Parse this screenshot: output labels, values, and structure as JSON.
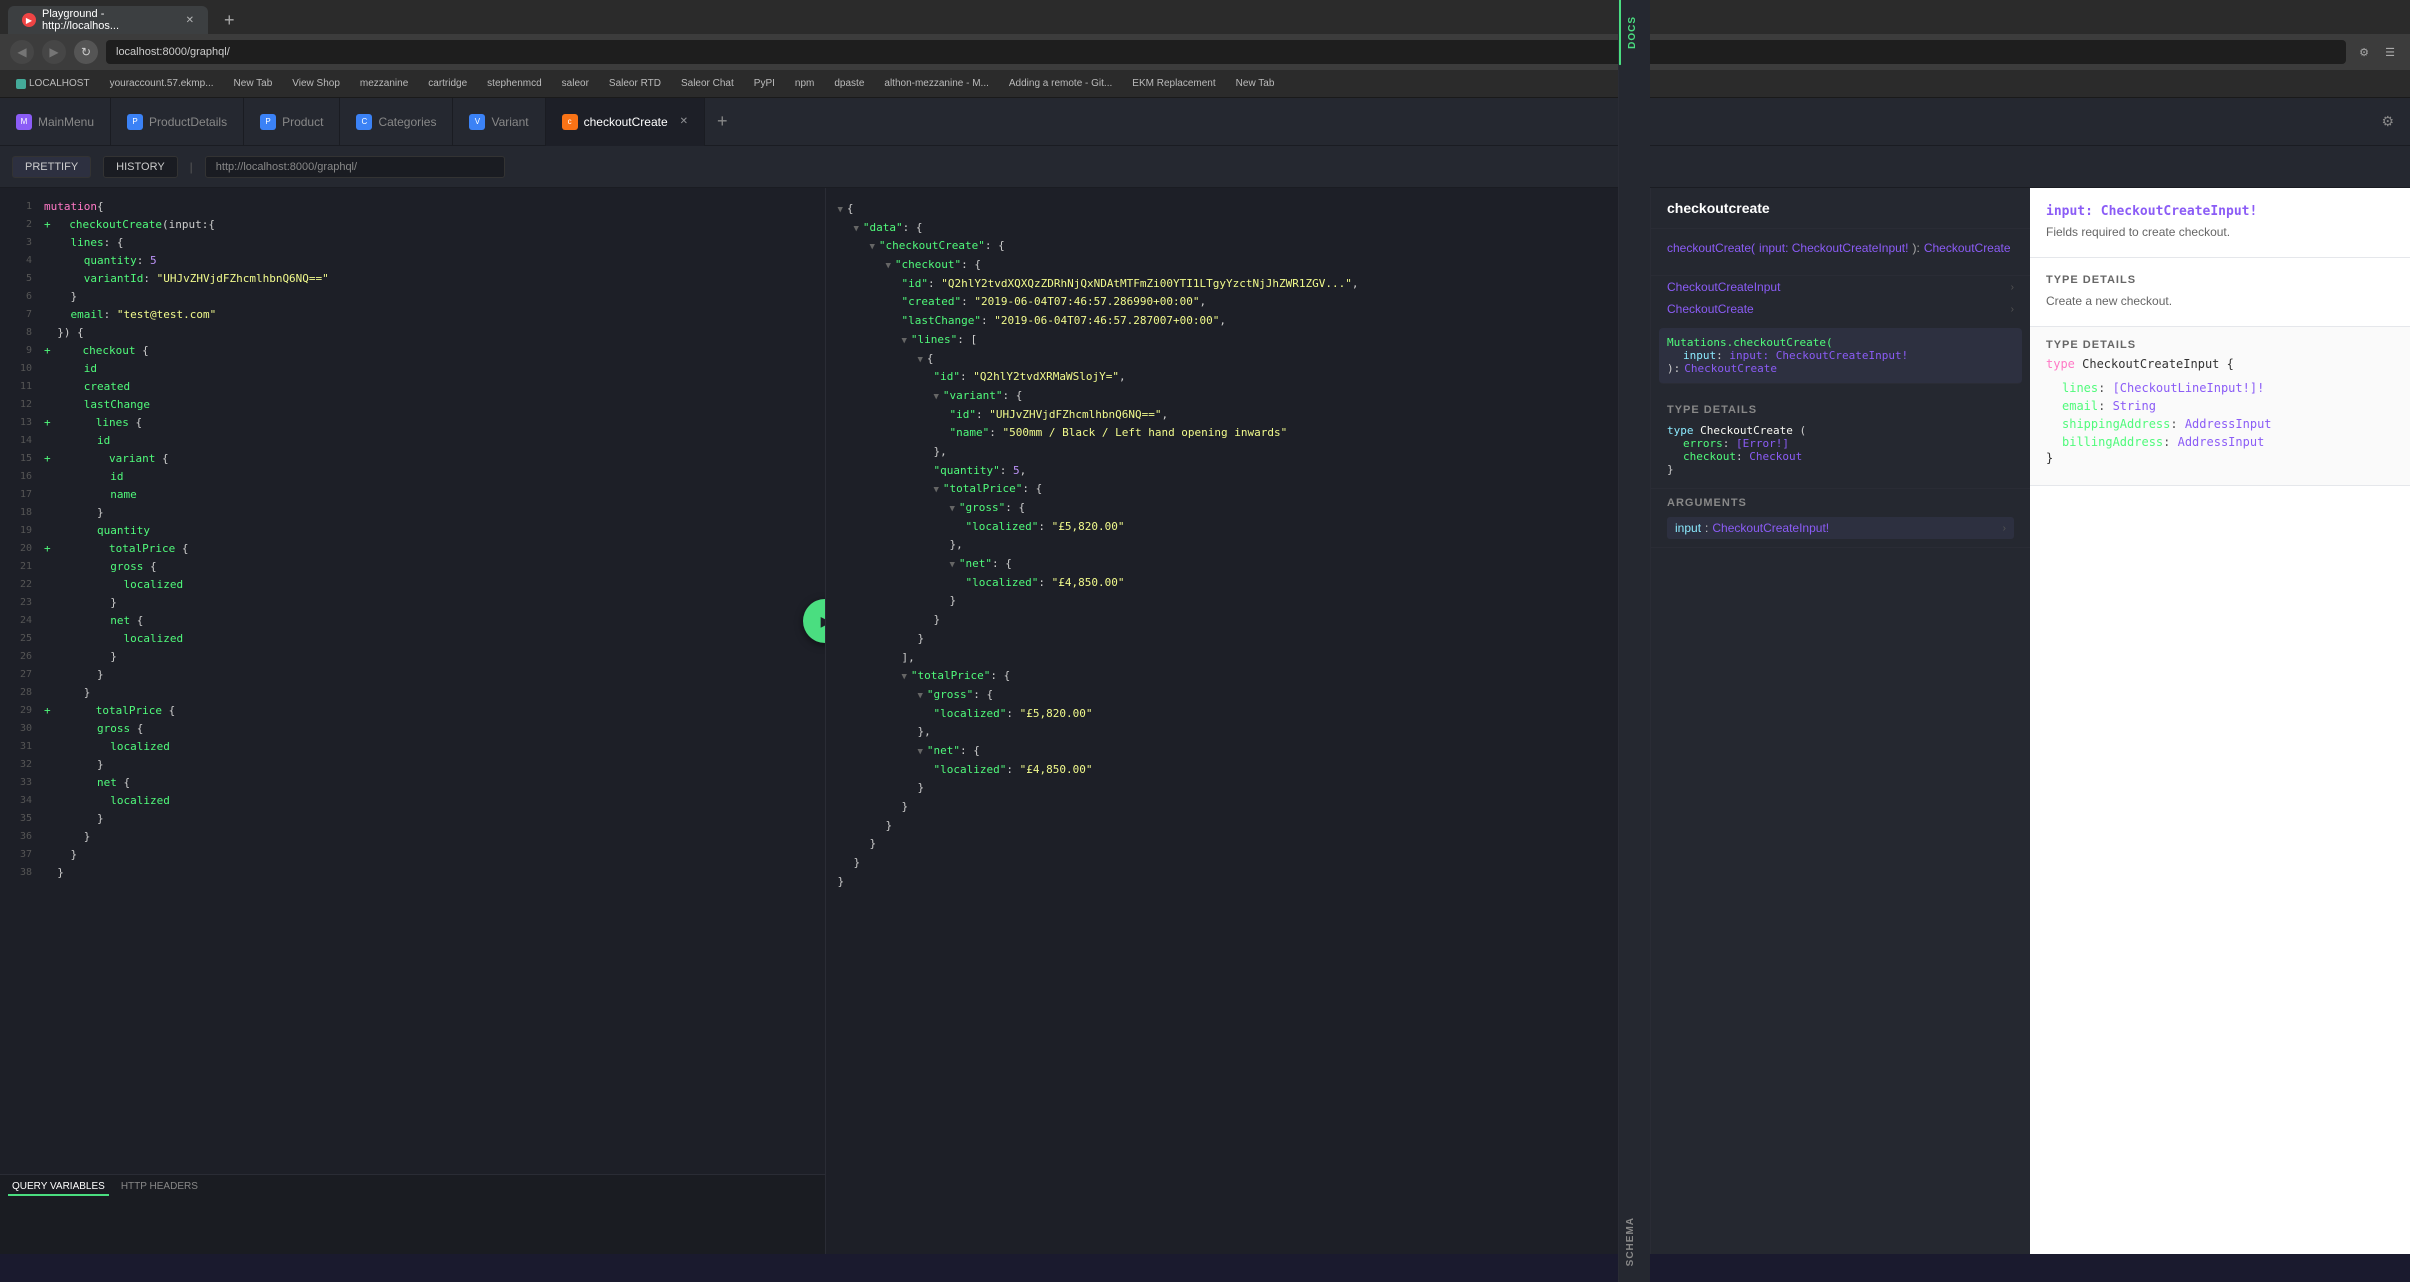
{
  "browser": {
    "tab1_title": "Playground - http://localhos...",
    "tab1_url": "localhost:8000/graphql/",
    "address": "localhost:8000/graphql/",
    "favicon_color": "#e44"
  },
  "bookmarks": [
    "LOCALHOST",
    "youraccount.57.ekmp...",
    "New Tab",
    "View Shop",
    "mezzanine",
    "cartridge",
    "stephenmcd",
    "saleor",
    "Saleor RTD",
    "Saleor Chat",
    "PyPI",
    "npm",
    "dpaste",
    "althon-mezzanine - M...",
    "Adding a remote - Git...",
    "EKM Replacement",
    "New Tab"
  ],
  "app_tabs": [
    {
      "label": "MainMenu",
      "icon_type": "purple",
      "icon_letter": "M",
      "active": false
    },
    {
      "label": "ProductDetails",
      "icon_type": "blue",
      "icon_letter": "P",
      "active": false
    },
    {
      "label": "Product",
      "icon_type": "blue",
      "icon_letter": "P",
      "active": false
    },
    {
      "label": "Categories",
      "icon_type": "blue",
      "icon_letter": "C",
      "active": false
    },
    {
      "label": "Variant",
      "icon_type": "blue",
      "icon_letter": "V",
      "active": false
    },
    {
      "label": "checkoutCreate",
      "icon_type": "orange",
      "icon_letter": "c",
      "active": true,
      "closeable": true
    }
  ],
  "toolbar": {
    "prettify": "PRETTIFY",
    "history": "HISTORY",
    "url": "http://localhost:8000/graphql/"
  },
  "query_lines": [
    {
      "num": "1",
      "content": "mutation{",
      "tokens": [
        {
          "t": "mutation",
          "c": "kw-mutation"
        },
        {
          "t": "{",
          "c": "punct"
        }
      ]
    },
    {
      "num": "2",
      "content": "  checkoutCreate(input:{",
      "indicator": "+"
    },
    {
      "num": "3",
      "content": "    lines: {"
    },
    {
      "num": "4",
      "content": "      quantity: 5",
      "value_type": "num"
    },
    {
      "num": "5",
      "content": "      variantId: \"UHJvZHVjdFZhcmlhbnQ6NQ==\"",
      "value_type": "str"
    },
    {
      "num": "6",
      "content": "    }"
    },
    {
      "num": "7",
      "content": "    email: \"test@test.com\"",
      "value_type": "str"
    },
    {
      "num": "8",
      "content": "  }) {"
    },
    {
      "num": "9",
      "content": "    checkout {",
      "indicator": "+"
    },
    {
      "num": "10",
      "content": "      id"
    },
    {
      "num": "11",
      "content": "      created"
    },
    {
      "num": "12",
      "content": "      lastChange"
    },
    {
      "num": "13",
      "content": "      lines {",
      "indicator": "+"
    },
    {
      "num": "14",
      "content": "        id"
    },
    {
      "num": "15",
      "content": "        variant {",
      "indicator": "+"
    },
    {
      "num": "16",
      "content": "          id"
    },
    {
      "num": "17",
      "content": "          name"
    },
    {
      "num": "18",
      "content": "        }"
    },
    {
      "num": "19",
      "content": "        quantity"
    },
    {
      "num": "20",
      "content": "        totalPrice {",
      "indicator": "+"
    },
    {
      "num": "21",
      "content": "          gross {"
    },
    {
      "num": "22",
      "content": "            localized"
    },
    {
      "num": "23",
      "content": "          }"
    },
    {
      "num": "24",
      "content": "          net {"
    },
    {
      "num": "25",
      "content": "            localized"
    },
    {
      "num": "26",
      "content": "          }"
    },
    {
      "num": "27",
      "content": "        }"
    },
    {
      "num": "28",
      "content": "      }"
    },
    {
      "num": "29",
      "content": "      totalPrice {",
      "indicator": "+"
    },
    {
      "num": "30",
      "content": "        gross {"
    },
    {
      "num": "31",
      "content": "          localized"
    },
    {
      "num": "32",
      "content": "        }"
    },
    {
      "num": "33",
      "content": "        net {"
    },
    {
      "num": "34",
      "content": "          localized"
    },
    {
      "num": "35",
      "content": "        }"
    },
    {
      "num": "36",
      "content": "      }"
    },
    {
      "num": "37",
      "content": "    }"
    },
    {
      "num": "38",
      "content": "  }"
    }
  ],
  "response": {
    "raw": "{\n  \"data\": {\n    \"checkoutCreate\": {\n      \"checkout\": {\n        \"id\": \"Q2hlY2tvdXQXQzZDRhNjQxNDAtMTFmZi00YTI1LTgyYzctNjJhZWR1ZGV...\",\n        \"created\": \"2019-06-04T07:46:57.286990+00:00\",\n        \"lastChange\": \"2019-06-04T07:46:57.287007+00:00\",\n        \"lines\": [\n          {\n            \"id\": \"Q2hlY2tvdXRMaWSlojY=\",\n            \"variant\": {\n              \"id\": \"UHJvZHVjdFZhcmlhbnQ6NQ==\",\n              \"name\": \"500mm / Black / Left hand opening inwards\"\n            },\n            \"quantity\": 5,\n            \"totalPrice\": {\n              \"gross\": {\n                \"localized\": \"£5,820.00\"\n              },\n              \"net\": {\n                \"localized\": \"£4,850.00\"\n              }\n            }\n          }\n        ],\n        \"totalPrice\": {\n          \"gross\": {\n            \"localized\": \"£5,820.00\"\n          },\n          \"net\": {\n            \"localized\": \"£4,850.00\"\n          }\n        }\n      }\n    }\n  }\n}"
  },
  "docs_panel": {
    "title": "checkoutcreate",
    "breadcrumb_root": "checkoutCreate(",
    "breadcrumb_input": "input: CheckoutCreateInput!",
    "breadcrumb_sep": "):",
    "breadcrumb_type": "CheckoutCreate",
    "section1_type_label": "TYPE DETAILS",
    "checkout_create_input_label": "CheckoutCreateInput",
    "checkout_create_label": "CheckoutCreate",
    "mutations_entry": "Mutations.checkoutCreate(",
    "mutations_input": "input: CheckoutCreateInput!",
    "mutations_result": "): CheckoutCreate",
    "type_details_label": "TYPE DETAILS",
    "type_header": "type CheckoutCreate {",
    "type_errors": "errors: [Error!]",
    "type_checkout": "checkout: Checkout",
    "type_close": "}",
    "arguments_label": "ARGUMENTS",
    "arg_input": "input:",
    "arg_input_type": "CheckoutCreateInput!"
  },
  "right_docs": {
    "header": "input: CheckoutCreateInput!",
    "sub_header": "Fields required to create checkout.",
    "type_details_label": "TYPE DETAILS",
    "type_desc": "Create a new checkout.",
    "type_header2_label": "TYPE DETAILS",
    "type_name": "type CheckoutCreateInput {",
    "fields": [
      {
        "name": "lines:",
        "type": "[CheckoutLineInput!]!"
      },
      {
        "name": "email:",
        "type": "String"
      },
      {
        "name": "shippingAddress:",
        "type": "AddressInput"
      },
      {
        "name": "billingAddress:",
        "type": "AddressInput"
      }
    ],
    "close_brace": "}"
  }
}
